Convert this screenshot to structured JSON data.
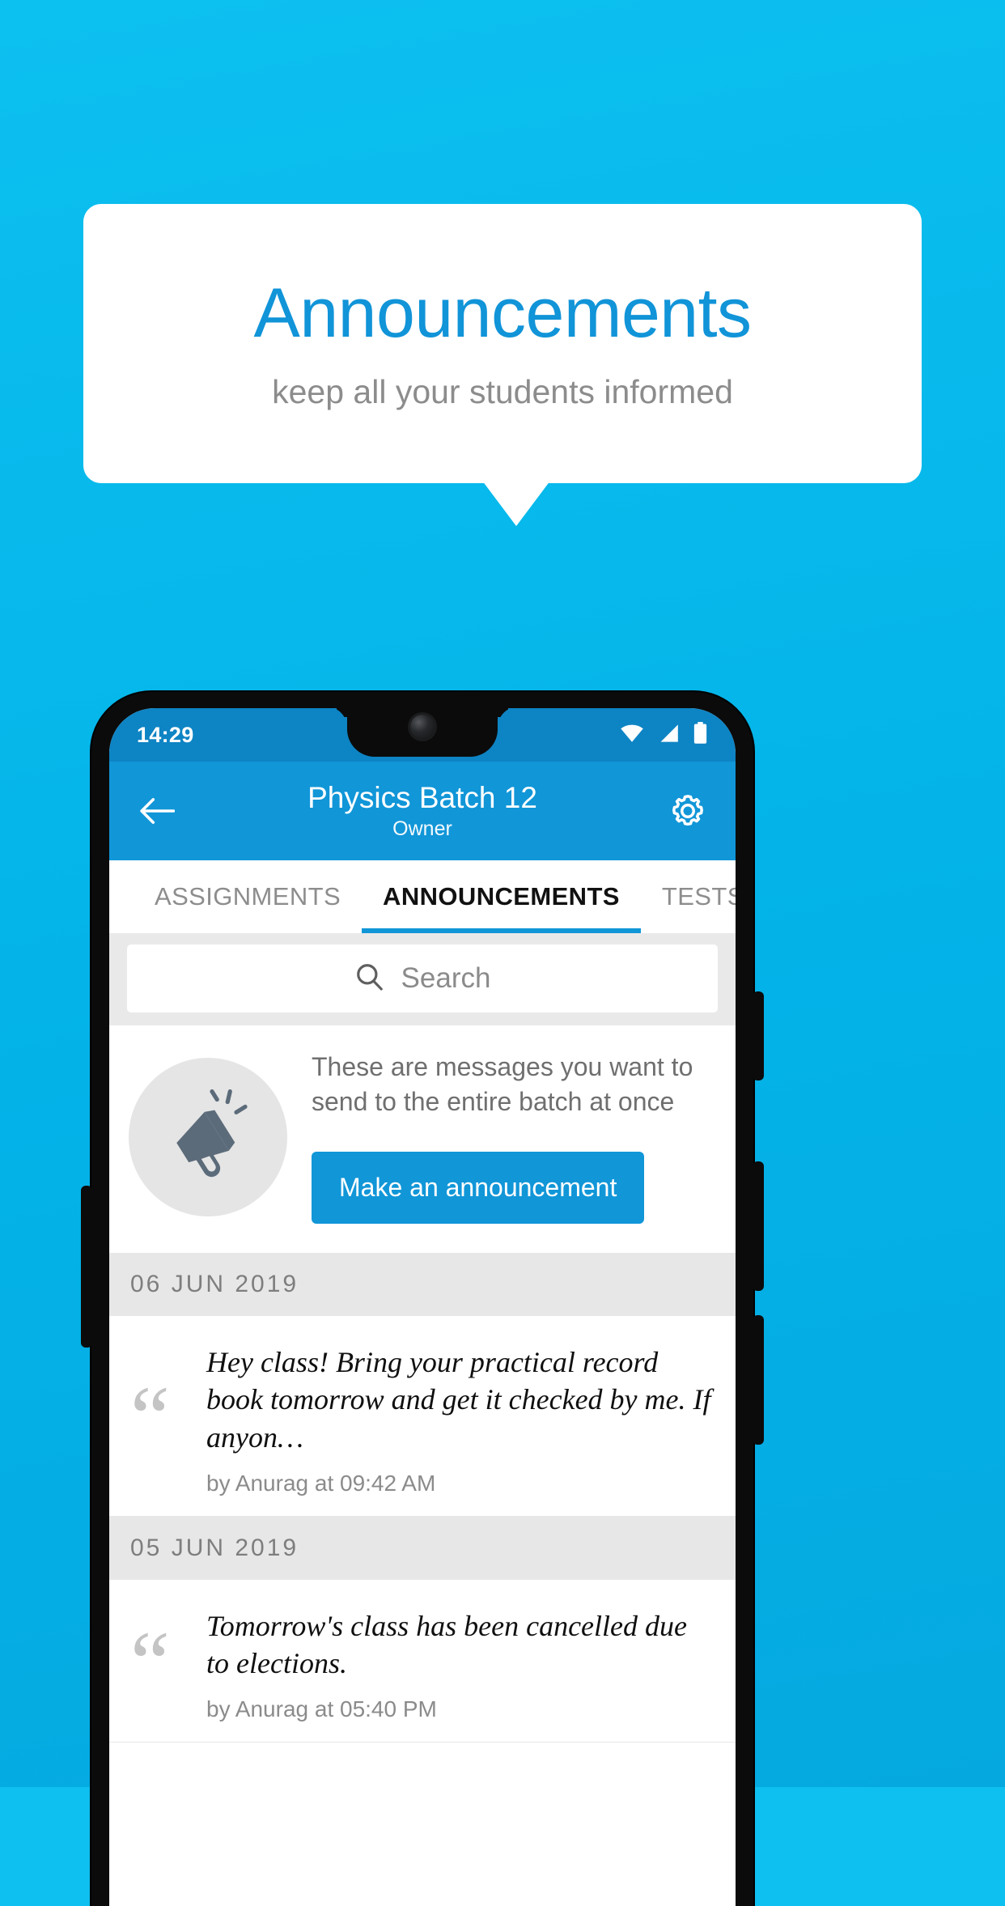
{
  "promo": {
    "title": "Announcements",
    "subtitle": "keep all your students informed",
    "title_color": "#1194d8",
    "background_color": "#0cc0f0"
  },
  "phone": {
    "status_bar": {
      "time": "14:29",
      "icons": [
        "wifi-icon",
        "cellular-signal-icon",
        "battery-icon"
      ]
    },
    "app_bar": {
      "back_icon": "back-arrow-icon",
      "title": "Physics Batch 12",
      "subtitle": "Owner",
      "settings_icon": "gear-icon",
      "background_color": "#1196d8"
    },
    "tabs": [
      {
        "label": "ASSIGNMENTS",
        "active": false
      },
      {
        "label": "ANNOUNCEMENTS",
        "active": true
      },
      {
        "label": "TESTS",
        "active": false
      },
      {
        "label": "’",
        "active": false
      }
    ],
    "search": {
      "icon": "search-icon",
      "placeholder": "Search",
      "value": ""
    },
    "empty_state": {
      "icon": "megaphone-icon",
      "description": "These are messages you want to send to the entire batch at once",
      "button_label": "Make an announcement",
      "button_color": "#1196d8"
    },
    "announcement_groups": [
      {
        "date": "06  JUN  2019",
        "items": [
          {
            "text": "Hey class! Bring your practical record book tomorrow and get it checked by me. If anyon…",
            "meta": "by Anurag at 09:42 AM"
          }
        ]
      },
      {
        "date": "05  JUN  2019",
        "items": [
          {
            "text": "Tomorrow's class has been cancelled due to elections.",
            "meta": "by Anurag at 05:40 PM"
          }
        ]
      }
    ]
  }
}
